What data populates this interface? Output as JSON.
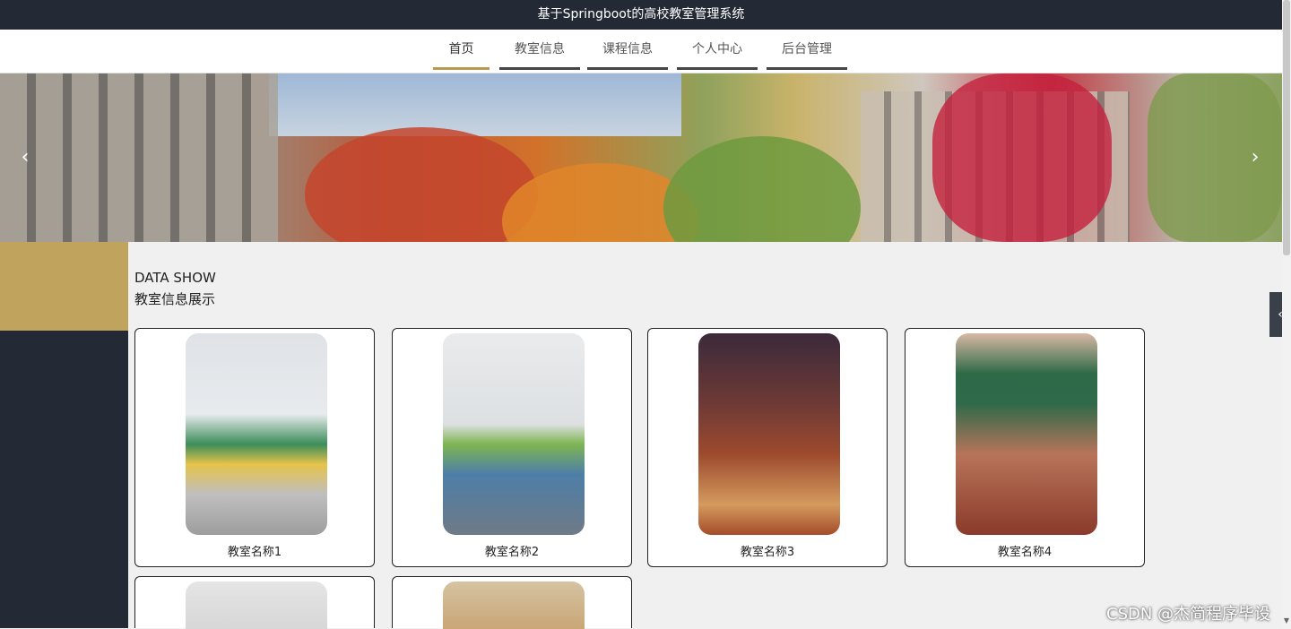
{
  "header": {
    "title": "基于Springboot的高校教室管理系统"
  },
  "nav": {
    "items": [
      {
        "label": "首页",
        "active": true
      },
      {
        "label": "教室信息",
        "active": false
      },
      {
        "label": "课程信息",
        "active": false
      },
      {
        "label": "个人中心",
        "active": false
      },
      {
        "label": "后台管理",
        "active": false
      }
    ]
  },
  "banner": {
    "prev_icon": "chevron-left-icon",
    "next_icon": "chevron-right-icon",
    "prev_glyph": "‹",
    "next_glyph": "›"
  },
  "section": {
    "title_en": "DATA SHOW",
    "title_cn": "教室信息展示"
  },
  "cards": [
    {
      "name": "教室名称1"
    },
    {
      "name": "教室名称2"
    },
    {
      "name": "教室名称3"
    },
    {
      "name": "教室名称4"
    },
    {
      "name": ""
    },
    {
      "name": ""
    }
  ],
  "side_toggle": {
    "icon": "chevron-left-icon",
    "glyph": "‹"
  },
  "watermark": "CSDN @杰简程序毕设",
  "colors": {
    "topbar": "#232a35",
    "accent": "#c0a35c",
    "sidebar": "#232a35"
  }
}
